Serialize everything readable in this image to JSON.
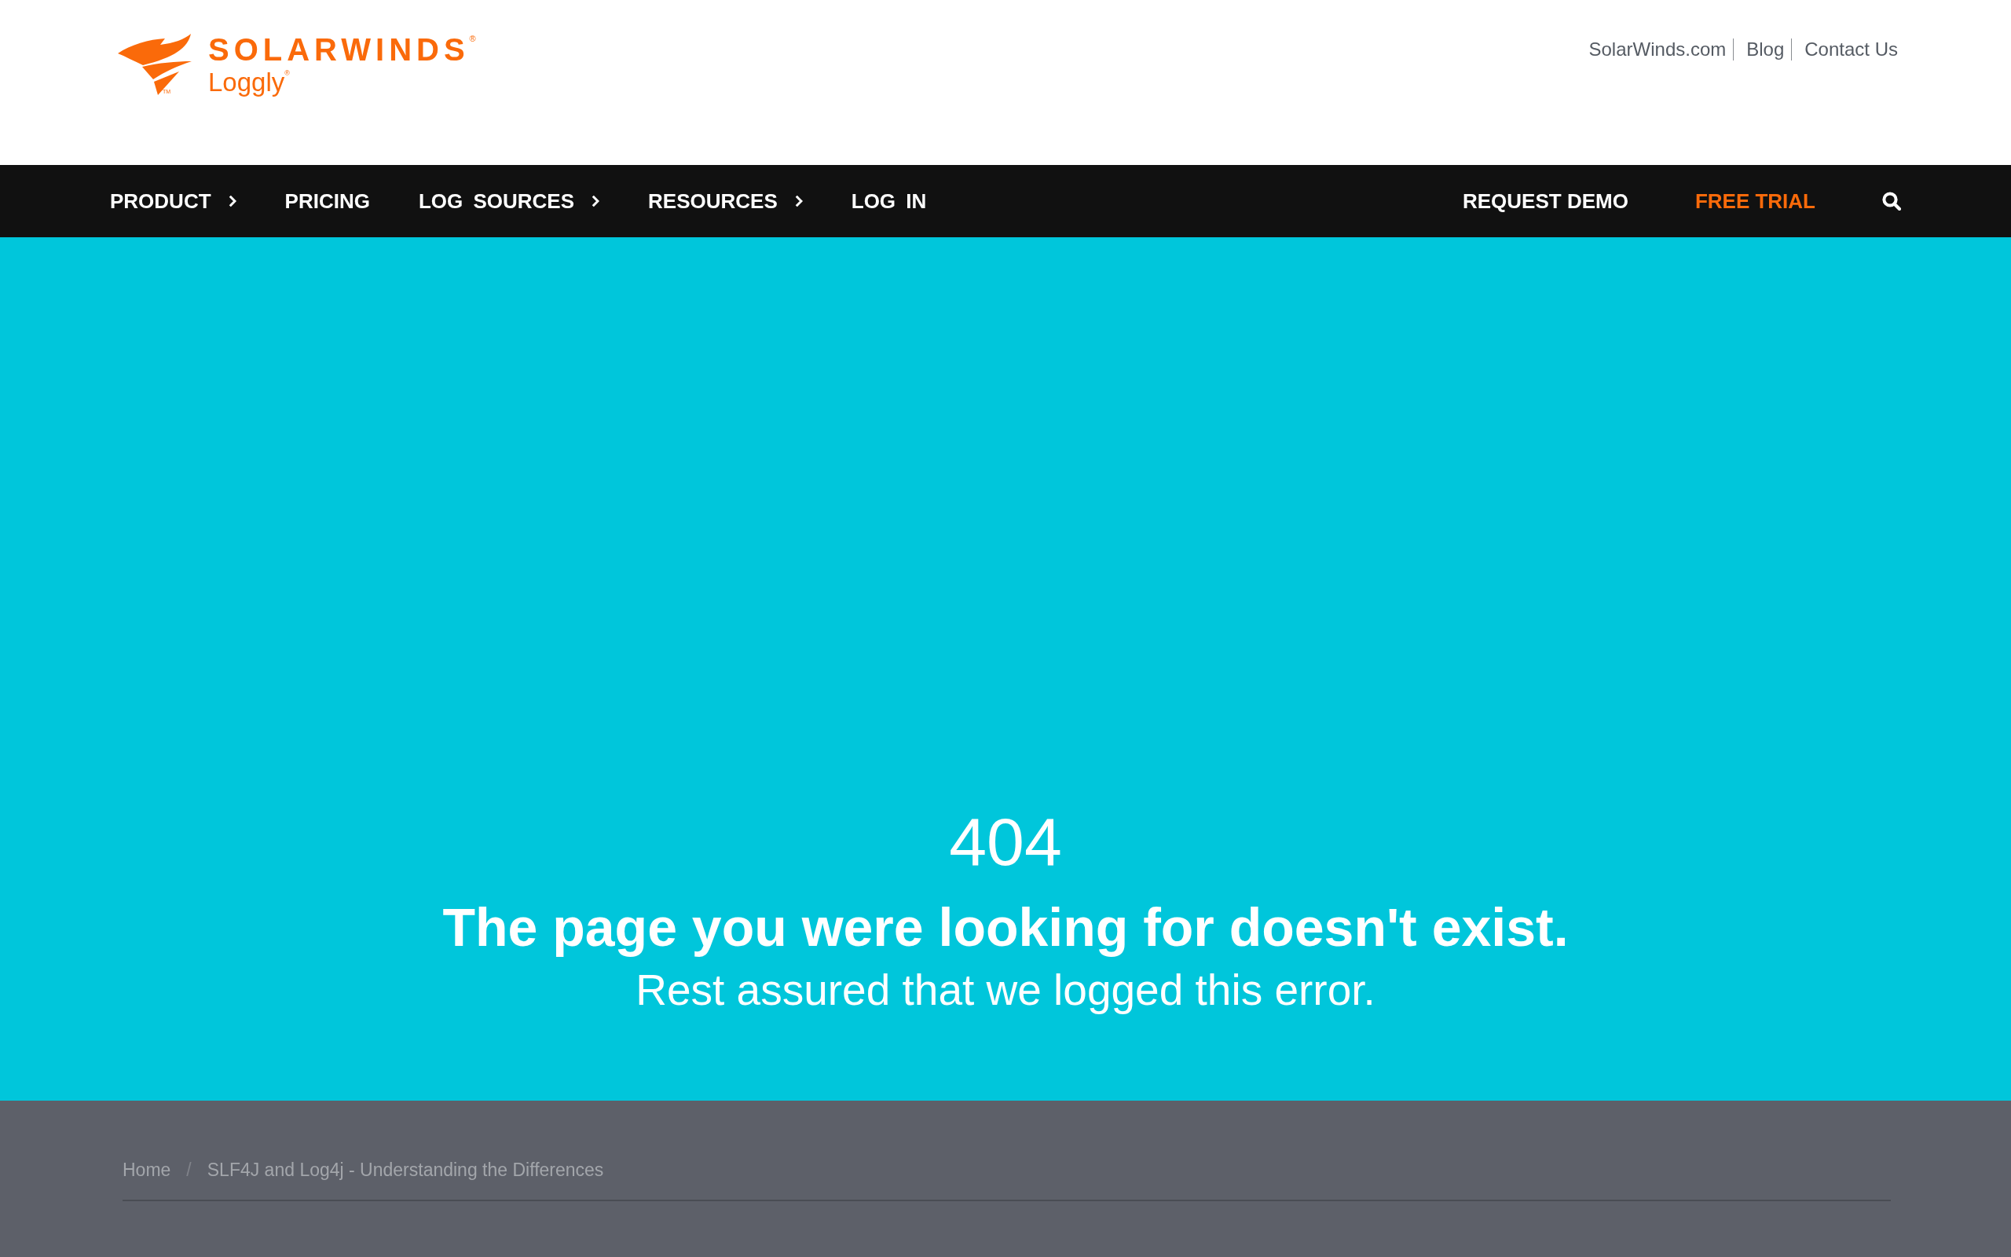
{
  "header": {
    "logo": {
      "brand": "SOLARWINDS$^{®}$",
      "product": "Loggly$^{®}$",
      "trademark": "TM"
    },
    "top_links": [
      "SolarWinds.com",
      "Blog",
      "Contact Us"
    ]
  },
  "nav": {
    "menu": [
      {
        "label": "PRODUCT",
        "has_submenu": true
      },
      {
        "label": "PRICING",
        "has_submenu": false
      },
      {
        "label": "LOG SOURCES",
        "has_submenu": true
      },
      {
        "label": "RESOURCES",
        "has_submenu": true
      },
      {
        "label": "LOG IN",
        "has_submenu": false
      }
    ],
    "actions": [
      {
        "label": "REQUEST DEMO",
        "kind": "link"
      },
      {
        "label": "FREE TRIAL",
        "kind": "cta"
      }
    ]
  },
  "hero": {
    "code": "404",
    "title": "The page you were looking for doesn't exist.",
    "message": "Rest assured that we logged this error."
  },
  "breadcrumb": {
    "items": [
      "Home",
      "SLF4J and Log4j - Understanding the Differences"
    ],
    "separator": "/"
  }
}
